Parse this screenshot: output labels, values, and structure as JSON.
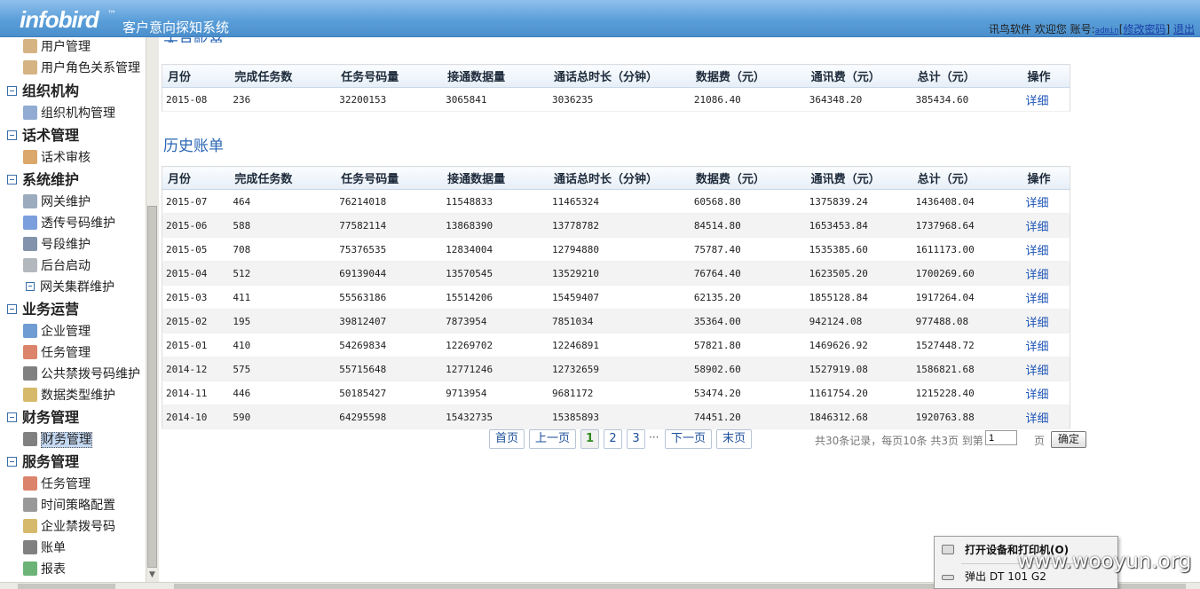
{
  "header": {
    "logo": "infobird",
    "logo_tm": "™",
    "app_title": "客户意向探知系统",
    "vendor": "讯鸟软件",
    "welcome": "欢迎您",
    "account_label": "账号:",
    "username": "admin",
    "change_password": "修改密码",
    "logout": "退出"
  },
  "sidebar": {
    "items": [
      {
        "label": "用户管理",
        "icon": "user-icon",
        "color": "#c89a5a"
      },
      {
        "label": "用户角色关系管理",
        "icon": "user-role-icon",
        "color": "#c89a5a"
      },
      {
        "group": "组织机构"
      },
      {
        "label": "组织机构管理",
        "icon": "org-chart-icon",
        "color": "#6c8fc4"
      },
      {
        "group": "话术管理"
      },
      {
        "label": "话术审核",
        "icon": "person-review-icon",
        "color": "#d08a3a"
      },
      {
        "group": "系统维护"
      },
      {
        "label": "网关维护",
        "icon": "key-icon",
        "color": "#7b8fa8"
      },
      {
        "label": "透传号码维护",
        "icon": "shield-icon",
        "color": "#4f7fd0"
      },
      {
        "label": "号段维护",
        "icon": "pen-icon",
        "color": "#5a6f8f"
      },
      {
        "label": "后台启动",
        "icon": "gear-icon",
        "color": "#9aa0a8"
      },
      {
        "label": "网关集群维护",
        "icon": "collapse-icon",
        "color": "#3a6ea8"
      },
      {
        "group": "业务运营"
      },
      {
        "label": "企业管理",
        "icon": "monitor-icon",
        "color": "#3f7bc4"
      },
      {
        "label": "任务管理",
        "icon": "calendar-icon",
        "color": "#d05a3a"
      },
      {
        "label": "公共禁拨号码维护",
        "icon": "document-icon",
        "color": "#555"
      },
      {
        "label": "数据类型维护",
        "icon": "data-type-icon",
        "color": "#c9a23a"
      },
      {
        "group": "财务管理"
      },
      {
        "label": "财务管理",
        "icon": "document-icon",
        "color": "#555",
        "active": true
      },
      {
        "group": "服务管理"
      },
      {
        "label": "任务管理",
        "icon": "calendar-icon",
        "color": "#d05a3a"
      },
      {
        "label": "时间策略配置",
        "icon": "clock-icon",
        "color": "#777"
      },
      {
        "label": "企业禁拨号码",
        "icon": "notebook-icon",
        "color": "#c9a23a"
      },
      {
        "label": "账单",
        "icon": "bill-icon",
        "color": "#555"
      },
      {
        "label": "报表",
        "icon": "bar-chart-icon",
        "color": "#3a9a4a"
      }
    ]
  },
  "current_bill": {
    "headers": [
      "月份",
      "完成任务数",
      "任务号码量",
      "接通数据量",
      "通话总时长（分钟）",
      "数据费（元）",
      "通讯费（元）",
      "总计（元）",
      "操作"
    ],
    "rows": [
      [
        "2015-08",
        "236",
        "32200153",
        "3065841",
        "3036235",
        "21086.40",
        "364348.20",
        "385434.60",
        "详细"
      ]
    ]
  },
  "history": {
    "title": "历史账单",
    "headers": [
      "月份",
      "完成任务数",
      "任务号码量",
      "接通数据量",
      "通话总时长（分钟）",
      "数据费（元）",
      "通讯费（元）",
      "总计（元）",
      "操作"
    ],
    "rows": [
      [
        "2015-07",
        "464",
        "76214018",
        "11548833",
        "11465324",
        "60568.80",
        "1375839.24",
        "1436408.04",
        "详细"
      ],
      [
        "2015-06",
        "588",
        "77582114",
        "13868390",
        "13778782",
        "84514.80",
        "1653453.84",
        "1737968.64",
        "详细"
      ],
      [
        "2015-05",
        "708",
        "75376535",
        "12834004",
        "12794880",
        "75787.40",
        "1535385.60",
        "1611173.00",
        "详细"
      ],
      [
        "2015-04",
        "512",
        "69139044",
        "13570545",
        "13529210",
        "76764.40",
        "1623505.20",
        "1700269.60",
        "详细"
      ],
      [
        "2015-03",
        "411",
        "55563186",
        "15514206",
        "15459407",
        "62135.20",
        "1855128.84",
        "1917264.04",
        "详细"
      ],
      [
        "2015-02",
        "195",
        "39812407",
        "7873954",
        "7851034",
        "35364.00",
        "942124.08",
        "977488.08",
        "详细"
      ],
      [
        "2015-01",
        "410",
        "54269834",
        "12269702",
        "12246891",
        "57821.80",
        "1469626.92",
        "1527448.72",
        "详细"
      ],
      [
        "2014-12",
        "575",
        "55715648",
        "12771246",
        "12732659",
        "58902.60",
        "1527919.08",
        "1586821.68",
        "详细"
      ],
      [
        "2014-11",
        "446",
        "50185427",
        "9713954",
        "9681172",
        "53474.20",
        "1161754.20",
        "1215228.40",
        "详细"
      ],
      [
        "2014-10",
        "590",
        "64295598",
        "15432735",
        "15385893",
        "74451.20",
        "1846312.68",
        "1920763.88",
        "详细"
      ]
    ]
  },
  "pager": {
    "first": "首页",
    "prev": "上一页",
    "pages": [
      "1",
      "2",
      "3"
    ],
    "ellipsis": "···",
    "next": "下一页",
    "last": "末页",
    "info": "共30条记录，每页10条 共3页 到第",
    "input_value": "1",
    "unit": "页",
    "confirm": "确定"
  },
  "context_menu": {
    "items": [
      "打开设备和打印机(O)",
      "弹出 DT 101 G2"
    ]
  },
  "watermark": "www.wooyun.org"
}
